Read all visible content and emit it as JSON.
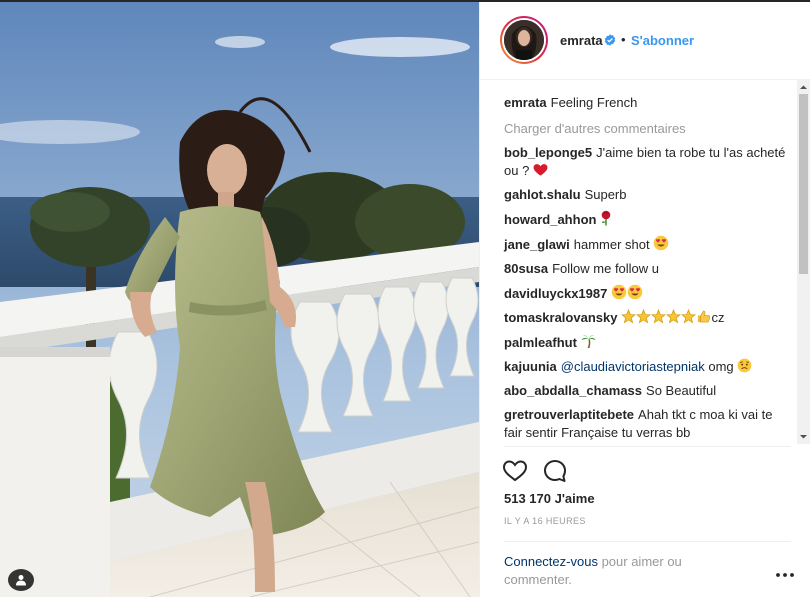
{
  "post": {
    "username": "emrata",
    "separator": "•",
    "follow_label": "S'abonner",
    "caption_user": "emrata",
    "caption_text": "Feeling French",
    "load_more": "Charger d'autres commentaires",
    "likes": "513 170 J'aime",
    "time": "IL Y A 16 HEURES",
    "login_link": "Connectez-vous",
    "login_text": " pour aimer ou commenter."
  },
  "comments": [
    {
      "user": "bob_leponge5",
      "text": "J'aime bien ta robe tu l'as acheté ou ?",
      "emoji": "heart"
    },
    {
      "user": "gahlot.shalu",
      "text": "Superb",
      "emoji": ""
    },
    {
      "user": "howard_ahhon",
      "text": "",
      "emoji": "rose"
    },
    {
      "user": "jane_glawi",
      "text": "hammer shot",
      "emoji": "heart-eyes"
    },
    {
      "user": "80susa",
      "text": "Follow me follow u",
      "emoji": ""
    },
    {
      "user": "davidluyckx1987",
      "text": "",
      "emoji": "heart-eyes-2"
    },
    {
      "user": "tomaskralovansky",
      "text": "cz",
      "emoji": "stars-thumb"
    },
    {
      "user": "palmleafhut",
      "text": "",
      "emoji": "palm"
    },
    {
      "user": "kajuunia",
      "mention": "@claudiavictoriastepniak",
      "text": "omg",
      "emoji": "sad"
    },
    {
      "user": "abo_abdalla_chamass",
      "text": "So Beautiful",
      "emoji": ""
    },
    {
      "user": "gretrouverlaptitebete",
      "text": "Ahah tkt c moa ki vai te fair sentir Française tu verras bb",
      "emoji": ""
    }
  ],
  "icons": {
    "like": "heart-outline-icon",
    "comment": "speech-bubble-icon",
    "more": "more-dots-icon",
    "verified": "verified-badge-icon",
    "tag": "user-tag-icon"
  },
  "colors": {
    "link": "#3897f0",
    "text": "#262626",
    "muted": "#999999",
    "mention": "#003569"
  }
}
